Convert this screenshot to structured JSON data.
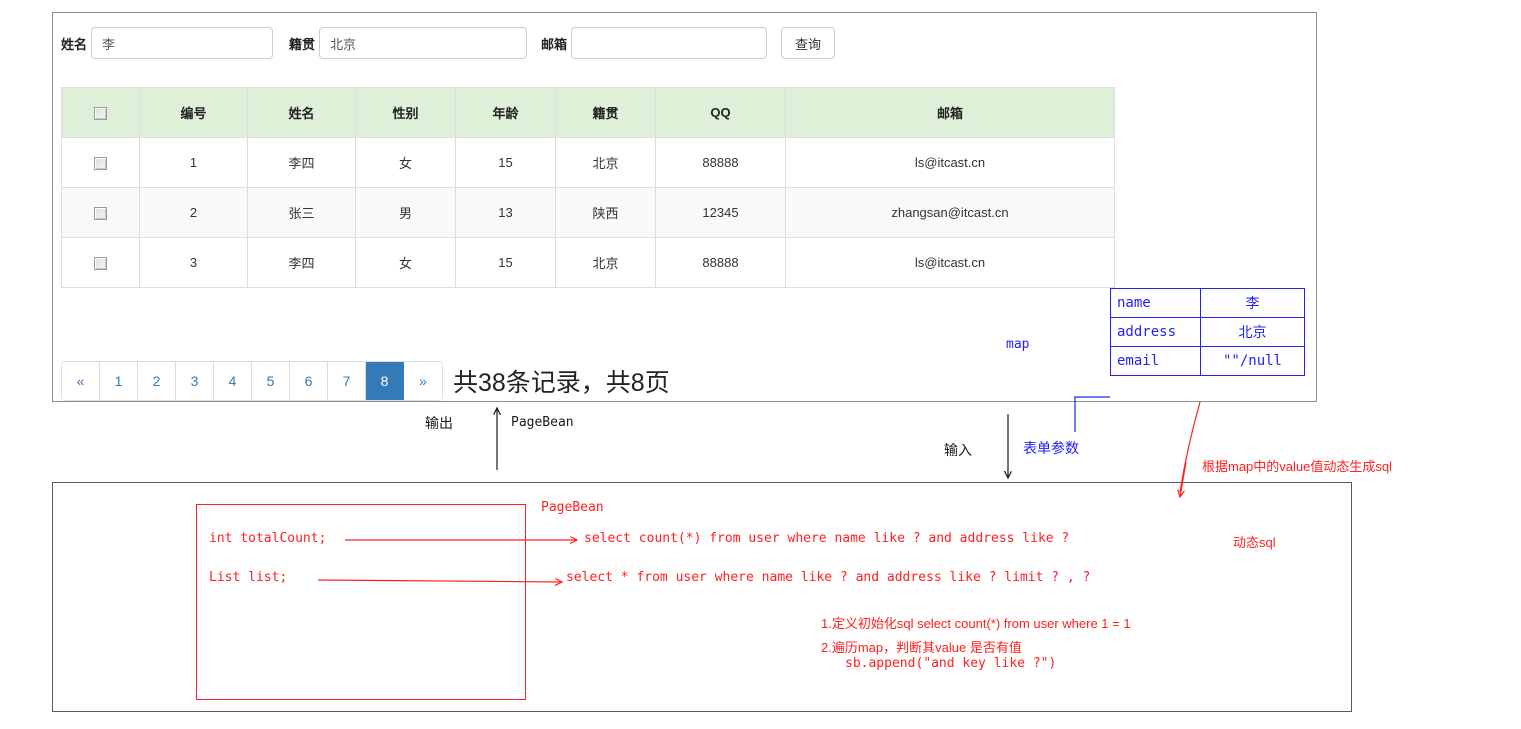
{
  "search_form": {
    "name_label": "姓名",
    "name_value": "李",
    "address_label": "籍贯",
    "address_value": "北京",
    "email_label": "邮箱",
    "email_value": "",
    "email_placeholder": "",
    "query_button": "查询"
  },
  "table": {
    "headers": [
      "",
      "编号",
      "姓名",
      "性别",
      "年龄",
      "籍贯",
      "QQ",
      "邮箱"
    ],
    "rows": [
      {
        "id": "1",
        "name": "李四",
        "sex": "女",
        "age": "15",
        "address": "北京",
        "qq": "88888",
        "email": "ls@itcast.cn"
      },
      {
        "id": "2",
        "name": "张三",
        "sex": "男",
        "age": "13",
        "address": "陕西",
        "qq": "12345",
        "email": "zhangsan@itcast.cn"
      },
      {
        "id": "3",
        "name": "李四",
        "sex": "女",
        "age": "15",
        "address": "北京",
        "qq": "88888",
        "email": "ls@itcast.cn"
      }
    ]
  },
  "pagination": {
    "prev": "«",
    "pages": [
      "1",
      "2",
      "3",
      "4",
      "5",
      "6",
      "7",
      "8"
    ],
    "active_page": "8",
    "next": "»",
    "summary": "共38条记录，共8页"
  },
  "map_annotation": {
    "label": "map",
    "rows": [
      {
        "key": "name",
        "value": "李"
      },
      {
        "key": "address",
        "value": "北京"
      },
      {
        "key": "email",
        "value": "\"\"/null"
      }
    ]
  },
  "connectors": {
    "output_label": "输出",
    "output_type": "PageBean",
    "input_label": "输入",
    "input_type": "表单参数",
    "dynamic_sql_note": "根据map中的value值动态生成sql"
  },
  "bottom": {
    "pagebean_title": "PageBean",
    "field_total_count": "int totalCount;",
    "field_list": "List list;",
    "sql_count": "select count(*) from user where name like ? and address like ?",
    "sql_select": "select * from user where name like ? and address like ? limit ? , ?",
    "dynamic_sql_label": "动态sql",
    "note1": "1.定义初始化sql select count(*) from user where 1 = 1",
    "note2": "2.遍历map，判断其value 是否有值",
    "note2_sub": "sb.append(\"and  key like ?\")"
  },
  "colors": {
    "header_green": "#dff0d8",
    "pager_active": "#337ab7",
    "annotation_blue": "#2222ee",
    "annotation_red": "#ff2020"
  }
}
